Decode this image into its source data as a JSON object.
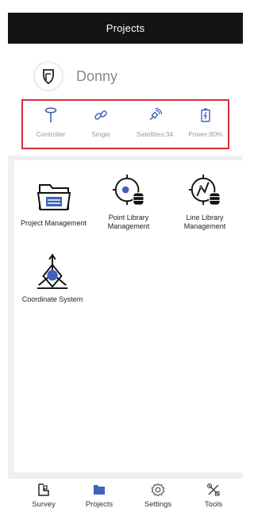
{
  "header": {
    "title": "Projects"
  },
  "user": {
    "name": "Donny",
    "avatar_icon": "logo-shield-icon"
  },
  "status_bar": {
    "highlight_color": "#d32e36",
    "items": [
      {
        "key": "controller",
        "label": "Controller",
        "icon": "antenna-icon"
      },
      {
        "key": "link",
        "label": "Single",
        "icon": "link-icon"
      },
      {
        "key": "satellites",
        "label": "Satellites:34",
        "icon": "satellite-icon"
      },
      {
        "key": "power",
        "label": "Power:80%",
        "icon": "battery-icon"
      }
    ]
  },
  "grid": {
    "items": [
      {
        "label": "Project Management",
        "icon": "folder-icon"
      },
      {
        "label": "Point Library Management",
        "icon": "point-library-icon"
      },
      {
        "label": "Line Library Management",
        "icon": "line-library-icon"
      },
      {
        "label": "Coordinate System",
        "icon": "coordinate-system-icon"
      }
    ]
  },
  "bottom_nav": {
    "active": "Projects",
    "accent_color": "#3f63b8",
    "items": [
      {
        "label": "Survey",
        "icon": "survey-icon"
      },
      {
        "label": "Projects",
        "icon": "projects-icon"
      },
      {
        "label": "Settings",
        "icon": "settings-icon"
      },
      {
        "label": "Tools",
        "icon": "tools-icon"
      }
    ]
  }
}
